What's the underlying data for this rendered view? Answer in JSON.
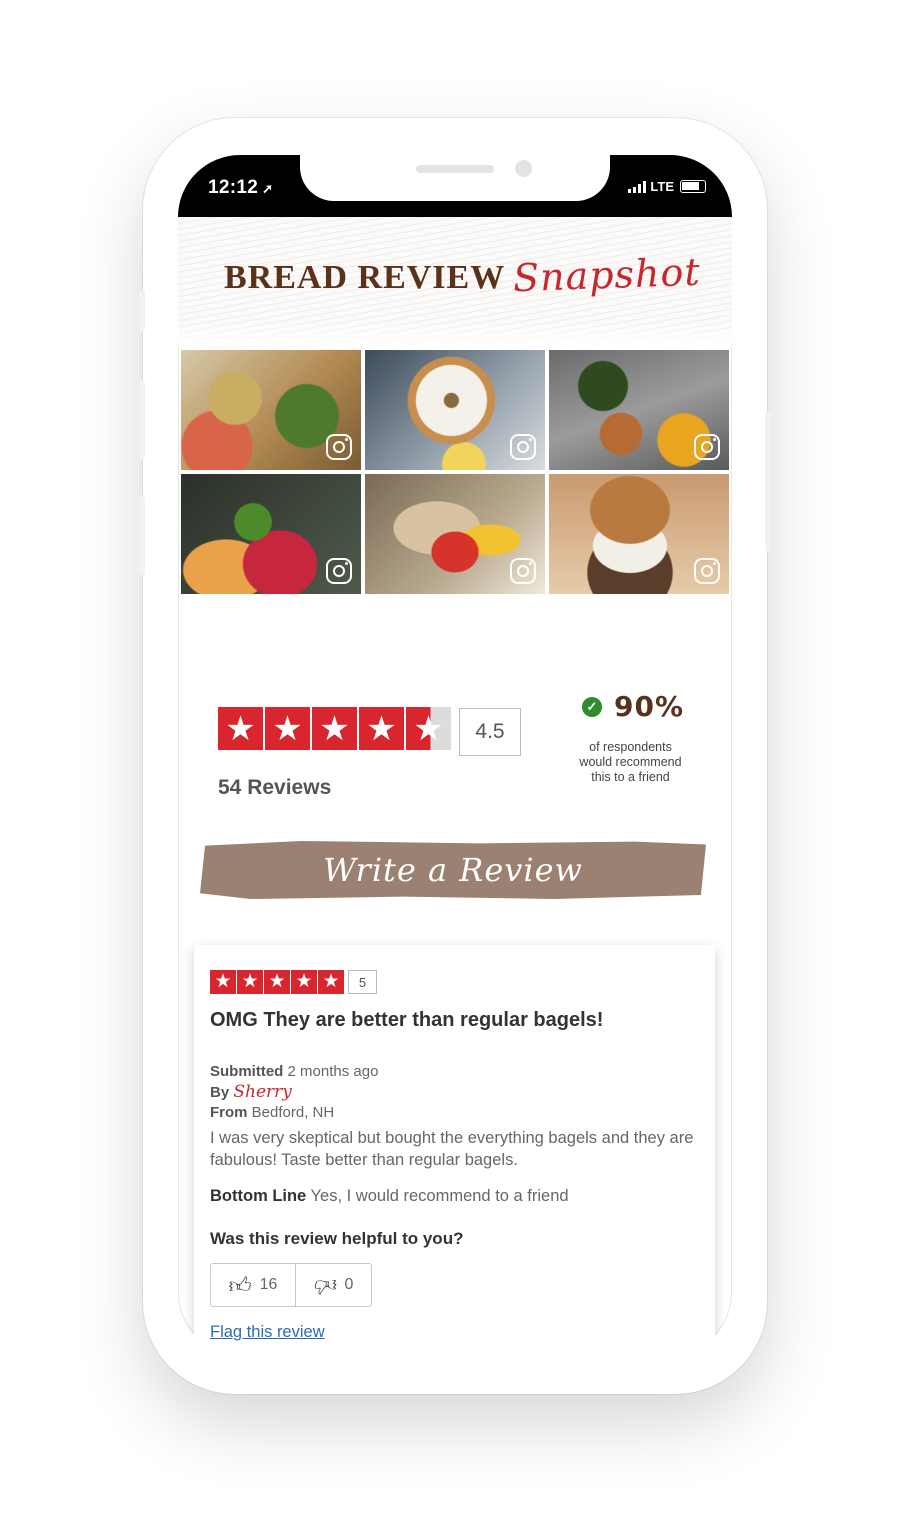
{
  "status_bar": {
    "time": "12:12",
    "network": "LTE"
  },
  "header": {
    "title_main": "BREAD REVIEW",
    "title_script": "Snapshot"
  },
  "photos": [
    {
      "icon": "instagram-icon"
    },
    {
      "icon": "instagram-icon"
    },
    {
      "icon": "instagram-icon"
    },
    {
      "icon": "instagram-icon"
    },
    {
      "icon": "instagram-icon"
    },
    {
      "icon": "instagram-icon"
    }
  ],
  "rating": {
    "average": "4.5",
    "stars": 4.5,
    "review_count": "54 Reviews"
  },
  "recommend": {
    "percent": "90%",
    "text": "of respondents would recommend this to a friend"
  },
  "write_review": {
    "label": "Write a Review"
  },
  "review": {
    "stars": 5,
    "score": "5",
    "title": "OMG They are better than regular bagels!",
    "submitted_label": "Submitted",
    "submitted_value": "2 months ago",
    "by_label": "By",
    "author": "Sherry",
    "from_label": "From",
    "from_value": "Bedford, NH",
    "body": "I was very skeptical but bought the everything bagels and they are fabulous! Taste better than regular bagels.",
    "bottom_line_label": "Bottom Line",
    "bottom_line_value": "Yes, I would recommend to a friend",
    "helpful_question": "Was this review helpful to you?",
    "helpful_yes": "16",
    "helpful_no": "0",
    "flag_label": "Flag this review"
  },
  "colors": {
    "brand_brown": "#5a321c",
    "accent_red": "#d9262e",
    "button_brown": "#9a8171",
    "link_blue": "#2a6db5"
  }
}
